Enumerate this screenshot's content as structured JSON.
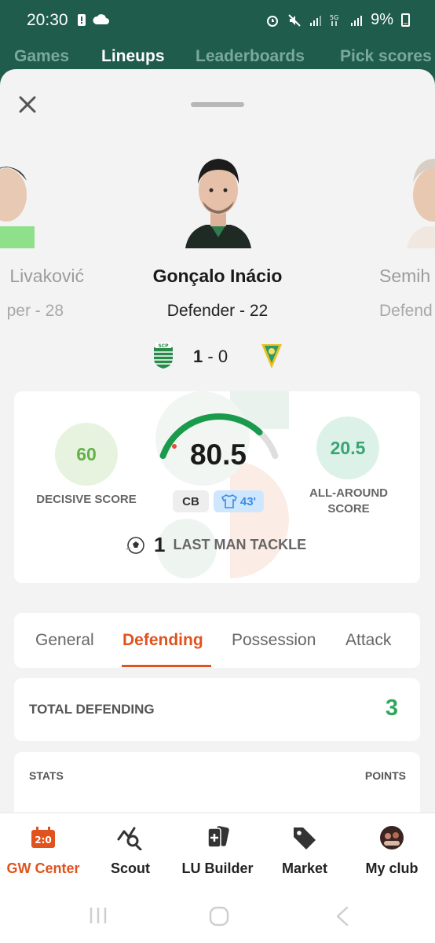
{
  "status_bar": {
    "time": "20:30",
    "battery": "9%"
  },
  "top_tabs": [
    {
      "label": "Games",
      "active": false
    },
    {
      "label": "Lineups",
      "active": true
    },
    {
      "label": "Leaderboards",
      "active": false
    },
    {
      "label": "Pick scores",
      "active": false
    }
  ],
  "carousel": {
    "prev": {
      "name": "Livaković",
      "sub": "per - 28"
    },
    "current": {
      "name": "Gonçalo Inácio",
      "sub": "Defender - 22"
    },
    "next": {
      "name": "Semih",
      "sub": "Defend"
    }
  },
  "match": {
    "home_score": "1",
    "separator": "-",
    "away_score": "0",
    "home_crest_text": "SCP"
  },
  "score_card": {
    "decisive_score": "60",
    "decisive_label": "DECISIVE SCORE",
    "total_score": "80.5",
    "total_score_fraction": 0.805,
    "all_around_score": "20.5",
    "all_around_label_1": "ALL-AROUND",
    "all_around_label_2": "SCORE",
    "position": "CB",
    "minutes": "43'",
    "action_count": "1",
    "action_label": "LAST MAN TACKLE"
  },
  "stat_tabs": [
    {
      "label": "General",
      "active": false
    },
    {
      "label": "Defending",
      "active": true
    },
    {
      "label": "Possession",
      "active": false
    },
    {
      "label": "Attack",
      "active": false
    }
  ],
  "total": {
    "label": "TOTAL DEFENDING",
    "value": "3"
  },
  "stats_table": {
    "col_stats": "STATS",
    "col_points": "POINTS"
  },
  "bottom_nav": [
    {
      "label": "GW Center",
      "icon": "gw-center-icon",
      "active": true
    },
    {
      "label": "Scout",
      "icon": "scout-icon",
      "active": false
    },
    {
      "label": "LU Builder",
      "icon": "cards-icon",
      "active": false
    },
    {
      "label": "Market",
      "icon": "tag-icon",
      "active": false
    },
    {
      "label": "My club",
      "icon": "club-avatar",
      "active": false
    }
  ],
  "colors": {
    "header_green": "#1f5c4b",
    "accent_orange": "#e0531e",
    "gauge_green": "#1a9a4b",
    "total_green": "#2fa85a"
  }
}
